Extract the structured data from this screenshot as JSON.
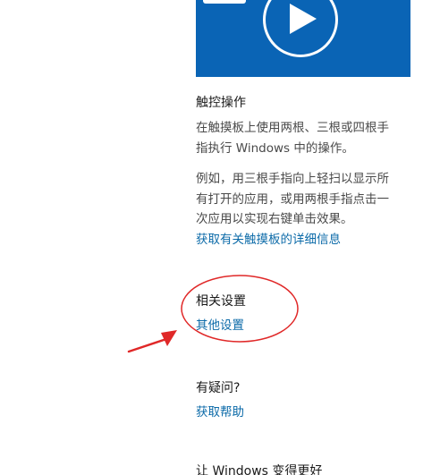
{
  "video": {
    "play_icon": "play-icon"
  },
  "touch_section": {
    "heading": "触控操作",
    "description_lines": [
      "在触摸板上使用两根、三根或四根手",
      "指执行 Windows 中的操作。"
    ],
    "example_lines": [
      "例如，用三根手指向上轻扫以显示所",
      "有打开的应用，或用两根手指点击一",
      "次应用以实现右键单击效果。"
    ],
    "more_info_link": "获取有关触摸板的详细信息"
  },
  "related_settings": {
    "heading": "相关设置",
    "other_settings_link": "其他设置"
  },
  "help_section": {
    "heading": "有疑问?",
    "get_help_link": "获取帮助"
  },
  "feedback_section": {
    "heading": "让 Windows 变得更好"
  },
  "annotation": {
    "color": "#e02828"
  },
  "colors": {
    "accent": "#0a64b5",
    "link": "#0b6aa8"
  }
}
